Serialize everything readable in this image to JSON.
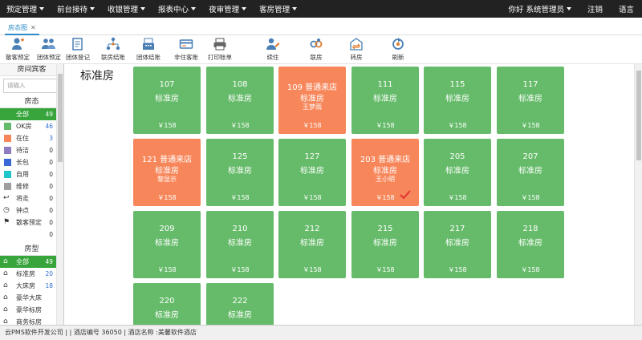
{
  "topnav": {
    "menus": [
      "预定管理",
      "前台接待",
      "收银管理",
      "报表中心",
      "夜审管理",
      "客房管理"
    ],
    "greeting": "你好 系统管理员",
    "logout": "注销",
    "language": "语言"
  },
  "tabs": [
    {
      "label": "房态图"
    }
  ],
  "toolbar": [
    {
      "label": "散客预定",
      "icon": "person-plus-icon"
    },
    {
      "label": "团体预定",
      "icon": "group-icon"
    },
    {
      "label": "团体登记",
      "icon": "register-book-icon"
    },
    {
      "label": "联房结账",
      "icon": "network-icon"
    },
    {
      "label": "团体结账",
      "icon": "cashier-icon"
    },
    {
      "label": "非住客账",
      "icon": "card-icon"
    },
    {
      "label": "打印账单",
      "icon": "printer-icon"
    },
    {
      "label": "续住",
      "icon": "person-edit-icon"
    },
    {
      "label": "联房",
      "icon": "link-icon"
    },
    {
      "label": "转房",
      "icon": "transfer-icon"
    },
    {
      "label": "刷新",
      "icon": "refresh-icon"
    }
  ],
  "sidebar": {
    "title": "房间宾客",
    "search_placeholder": "请输入",
    "status_title": "房态",
    "status_items": [
      {
        "label": "全部",
        "count": "49",
        "color": "#37a53b",
        "active": true
      },
      {
        "label": "OK房",
        "count": "46",
        "color": "#66bb6a"
      },
      {
        "label": "在住",
        "count": "3",
        "color": "#f7875b"
      },
      {
        "label": "待洁",
        "count": "0",
        "color": "#8e7cc3"
      },
      {
        "label": "长包",
        "count": "0",
        "color": "#3a67d6"
      },
      {
        "label": "自用",
        "count": "0",
        "color": "#1fc7cc"
      },
      {
        "label": "维修",
        "count": "0",
        "color": "#9e9e9e"
      },
      {
        "label": "将走",
        "count": "0",
        "icon": "exit-icon"
      },
      {
        "label": "钟点",
        "count": "0",
        "icon": "clock-icon"
      },
      {
        "label": "散客预定",
        "count": "0",
        "icon": "flag-icon"
      }
    ],
    "extra_count": "0",
    "type_title": "房型",
    "type_items": [
      {
        "label": "全部",
        "count": "49",
        "active": true
      },
      {
        "label": "标准房",
        "count": "20"
      },
      {
        "label": "大床房",
        "count": "18"
      },
      {
        "label": "豪华大床",
        "count": ""
      },
      {
        "label": "豪华标房",
        "count": ""
      },
      {
        "label": "商务标房",
        "count": ""
      }
    ]
  },
  "main": {
    "building_title": "标准房",
    "rooms": [
      {
        "no": "107",
        "type": "标准房",
        "guest": "",
        "price": "￥158",
        "status": "green"
      },
      {
        "no": "108",
        "type": "标准房",
        "guest": "",
        "price": "￥158",
        "status": "green"
      },
      {
        "no": "109 普通来店",
        "type": "标准房",
        "guest": "王梦雨",
        "price": "￥158",
        "status": "orange"
      },
      {
        "no": "111",
        "type": "标准房",
        "guest": "",
        "price": "￥158",
        "status": "green"
      },
      {
        "no": "115",
        "type": "标准房",
        "guest": "",
        "price": "￥158",
        "status": "green"
      },
      {
        "no": "117",
        "type": "标准房",
        "guest": "",
        "price": "￥158",
        "status": "green"
      },
      {
        "no": "121 普通来店",
        "type": "标准房",
        "guest": "黎显示",
        "price": "￥158",
        "status": "orange"
      },
      {
        "no": "125",
        "type": "标准房",
        "guest": "",
        "price": "￥158",
        "status": "green"
      },
      {
        "no": "127",
        "type": "标准房",
        "guest": "",
        "price": "￥158",
        "status": "green"
      },
      {
        "no": "203 普通来店",
        "type": "标准房",
        "guest": "王小明",
        "price": "￥158",
        "status": "orange",
        "checked": true
      },
      {
        "no": "205",
        "type": "标准房",
        "guest": "",
        "price": "￥158",
        "status": "green"
      },
      {
        "no": "207",
        "type": "标准房",
        "guest": "",
        "price": "￥158",
        "status": "green"
      },
      {
        "no": "209",
        "type": "标准房",
        "guest": "",
        "price": "￥158",
        "status": "green"
      },
      {
        "no": "210",
        "type": "标准房",
        "guest": "",
        "price": "￥158",
        "status": "green"
      },
      {
        "no": "212",
        "type": "标准房",
        "guest": "",
        "price": "￥158",
        "status": "green"
      },
      {
        "no": "215",
        "type": "标准房",
        "guest": "",
        "price": "￥158",
        "status": "green"
      },
      {
        "no": "217",
        "type": "标准房",
        "guest": "",
        "price": "￥158",
        "status": "green"
      },
      {
        "no": "218",
        "type": "标准房",
        "guest": "",
        "price": "￥158",
        "status": "green"
      },
      {
        "no": "220",
        "type": "标准房",
        "guest": "",
        "price": "",
        "status": "green"
      },
      {
        "no": "222",
        "type": "标准房",
        "guest": "",
        "price": "",
        "status": "green"
      }
    ]
  },
  "statusbar": {
    "text": "云PMS软件开发公司 | | 酒店编号  36050 | 酒店名称 :美馨软件酒店"
  }
}
